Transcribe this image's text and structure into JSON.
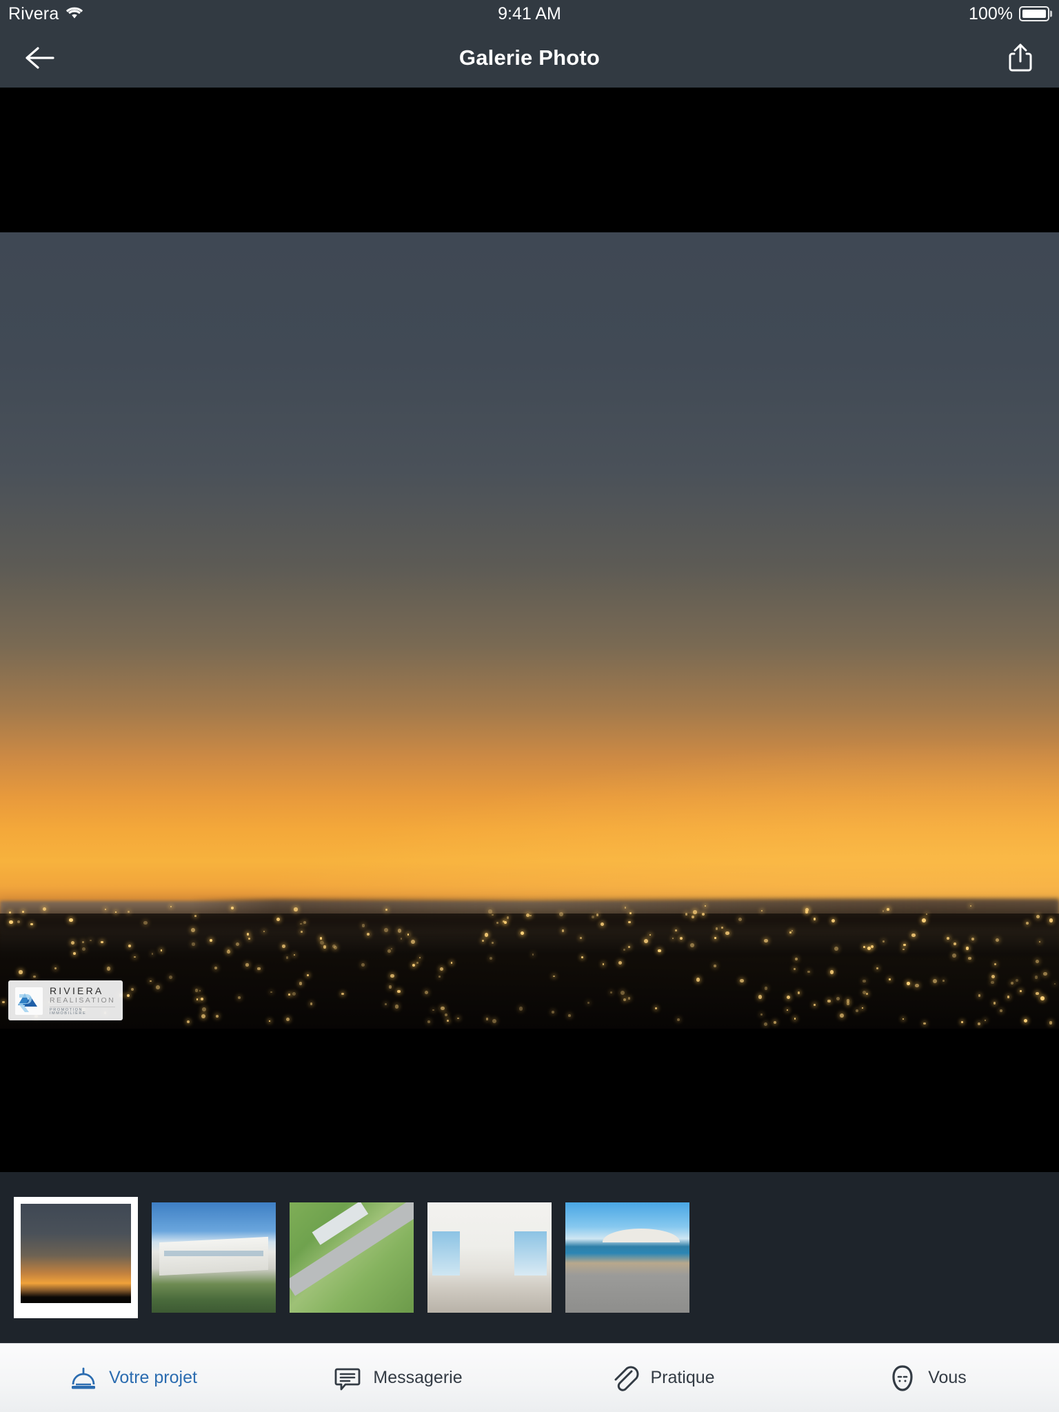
{
  "status_bar": {
    "carrier": "Rivera",
    "wifi_icon": "wifi-icon",
    "time": "9:41 AM",
    "battery_percent": "100%",
    "battery_icon": "battery-full-icon"
  },
  "nav_bar": {
    "title": "Galerie Photo",
    "back_icon": "arrow-left-icon",
    "share_icon": "share-icon",
    "background_color": "#323A42"
  },
  "viewer": {
    "background_color": "#000000",
    "watermark": {
      "line1": "RIVIERA",
      "line2": "REALISATION",
      "line3": "PROMOTION IMMOBILIÈRE",
      "logo_icon": "riviera-logo-icon"
    }
  },
  "thumbnails": {
    "background_color": "#1E242B",
    "selected_index": 0,
    "items": [
      {
        "name": "thumbnail-sunset-panorama",
        "style": "t-sunset",
        "selected": true
      },
      {
        "name": "thumbnail-residence-exterior",
        "style": "t-build",
        "selected": false
      },
      {
        "name": "thumbnail-aerial-site-plan",
        "style": "t-plan",
        "selected": false
      },
      {
        "name": "thumbnail-living-room-interior",
        "style": "t-inter",
        "selected": false
      },
      {
        "name": "thumbnail-terrace-sea-view",
        "style": "t-terr",
        "selected": false
      }
    ]
  },
  "tab_bar": {
    "active_color": "#2B6CB0",
    "inactive_color": "#333B44",
    "items": [
      {
        "label": "Votre projet",
        "icon": "hard-hat-icon",
        "active": true
      },
      {
        "label": "Messagerie",
        "icon": "chat-bubble-icon",
        "active": false
      },
      {
        "label": "Pratique",
        "icon": "paperclip-icon",
        "active": false
      },
      {
        "label": "Vous",
        "icon": "face-avatar-icon",
        "active": false
      }
    ]
  }
}
